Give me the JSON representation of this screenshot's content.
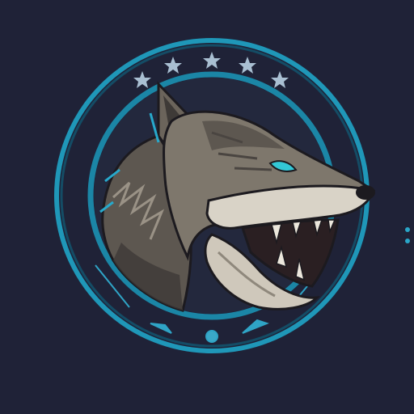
{
  "image": {
    "subject": "wolf-emblem",
    "icon": "wolf-head-icon"
  },
  "emblem": {
    "ring_decorations": {
      "top": "star-icon",
      "bottom": "arrow-icon"
    }
  },
  "colors": {
    "background": "#1f2237",
    "ring_outer": "#1f97b8",
    "ring_inner": "#1b86a6",
    "ring_accent": "#27a9cc",
    "star_color": "#a9bfd2",
    "wolf_fur_dark": "#5d5750",
    "wolf_fur_mid": "#7e776c",
    "wolf_fur_light": "#d9d3c7",
    "wolf_mouth": "#2a1f22",
    "wolf_eye": "#33c7d6",
    "wolf_outline": "#1c1a1f"
  }
}
